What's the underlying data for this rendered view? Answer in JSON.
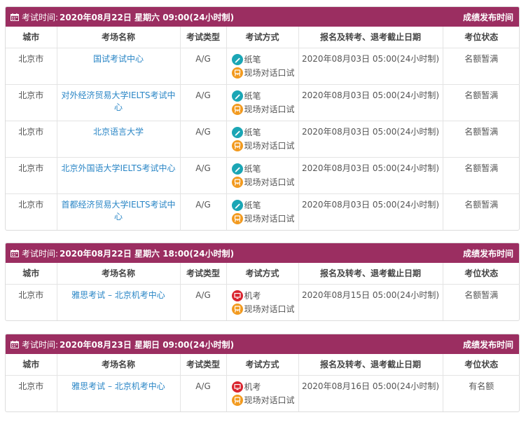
{
  "columns": [
    "城市",
    "考场名称",
    "考试类型",
    "考试方式",
    "报名及转考、退考截止日期",
    "考位状态"
  ],
  "header_label": "考试时间:",
  "release_label": "成绩发布时间",
  "sessions": [
    {
      "time": "2020年08月22日 星期六 09:00(24小时制)",
      "rows": [
        {
          "city": "北京市",
          "venue": "国试考试中心",
          "type": "A/G",
          "modes": [
            {
              "icon": "pen-icon",
              "label": "纸笔"
            },
            {
              "icon": "speaking-icon",
              "label": "现场对话口试"
            }
          ],
          "deadline": "2020年08月03日 05:00(24小时制)",
          "status": "名额暂满"
        },
        {
          "city": "北京市",
          "venue": "对外经济贸易大学IELTS考试中心",
          "type": "A/G",
          "modes": [
            {
              "icon": "pen-icon",
              "label": "纸笔"
            },
            {
              "icon": "speaking-icon",
              "label": "现场对话口试"
            }
          ],
          "deadline": "2020年08月03日 05:00(24小时制)",
          "status": "名额暂满"
        },
        {
          "city": "北京市",
          "venue": "北京语言大学",
          "type": "A/G",
          "modes": [
            {
              "icon": "pen-icon",
              "label": "纸笔"
            },
            {
              "icon": "speaking-icon",
              "label": "现场对话口试"
            }
          ],
          "deadline": "2020年08月03日 05:00(24小时制)",
          "status": "名额暂满"
        },
        {
          "city": "北京市",
          "venue": "北京外国语大学IELTS考试中心",
          "type": "A/G",
          "modes": [
            {
              "icon": "pen-icon",
              "label": "纸笔"
            },
            {
              "icon": "speaking-icon",
              "label": "现场对话口试"
            }
          ],
          "deadline": "2020年08月03日 05:00(24小时制)",
          "status": "名额暂满"
        },
        {
          "city": "北京市",
          "venue": "首都经济贸易大学IELTS考试中心",
          "type": "A/G",
          "modes": [
            {
              "icon": "pen-icon",
              "label": "纸笔"
            },
            {
              "icon": "speaking-icon",
              "label": "现场对话口试"
            }
          ],
          "deadline": "2020年08月03日 05:00(24小时制)",
          "status": "名额暂满"
        }
      ]
    },
    {
      "time": "2020年08月22日 星期六 18:00(24小时制)",
      "rows": [
        {
          "city": "北京市",
          "venue": "雅思考试 – 北京机考中心",
          "type": "A/G",
          "modes": [
            {
              "icon": "computer-icon",
              "label": "机考"
            },
            {
              "icon": "speaking-icon",
              "label": "现场对话口试"
            }
          ],
          "deadline": "2020年08月15日 05:00(24小时制)",
          "status": "名额暂满"
        }
      ]
    },
    {
      "time": "2020年08月23日 星期日 09:00(24小时制)",
      "rows": [
        {
          "city": "北京市",
          "venue": "雅思考试 – 北京机考中心",
          "type": "A/G",
          "modes": [
            {
              "icon": "computer-icon",
              "label": "机考"
            },
            {
              "icon": "speaking-icon",
              "label": "现场对话口试"
            }
          ],
          "deadline": "2020年08月16日 05:00(24小时制)",
          "status": "有名额"
        }
      ]
    }
  ],
  "colors": {
    "header": "#9b2e61",
    "link": "#2a86c6",
    "pen": "#1ba6b5",
    "speaking": "#f29a1f",
    "computer": "#d9242e"
  }
}
